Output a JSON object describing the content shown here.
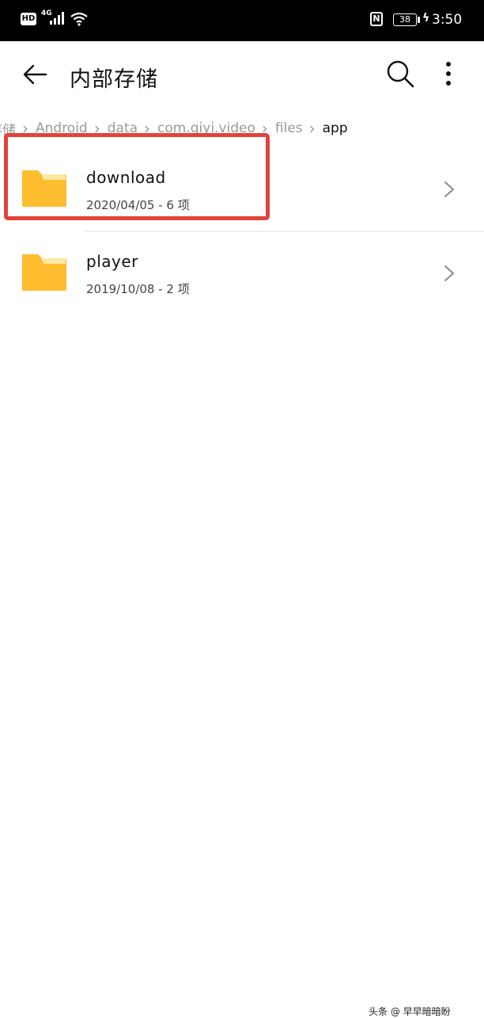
{
  "status_bar": {
    "hd": "HD",
    "network": "4G",
    "nfc": "N",
    "battery": "38",
    "time": "3:50"
  },
  "toolbar": {
    "title": "内部存储"
  },
  "breadcrumb": [
    "存储",
    "Android",
    "data",
    "com.qiyi.video",
    "files",
    "app"
  ],
  "items": [
    {
      "name": "download",
      "meta": "2020/04/05 - 6 项"
    },
    {
      "name": "player",
      "meta": "2019/10/08 - 2 项"
    }
  ],
  "colors": {
    "folder": "#FDBD2E",
    "folder_back": "#FFE8A6",
    "highlight": "#E2423B"
  },
  "watermark": "头条 @ 早早暗暗盼"
}
